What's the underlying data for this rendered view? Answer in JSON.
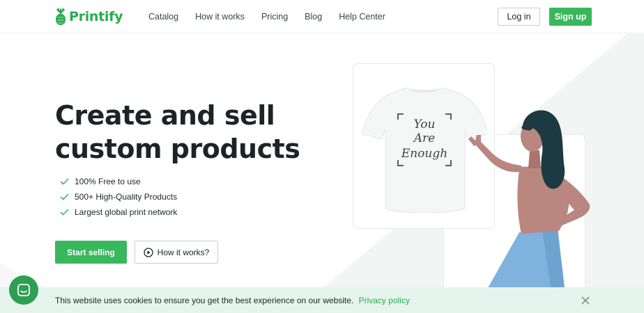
{
  "brand": {
    "name": "Printify",
    "color": "#29ab51"
  },
  "nav": {
    "items": [
      {
        "label": "Catalog"
      },
      {
        "label": "How it works"
      },
      {
        "label": "Pricing"
      },
      {
        "label": "Blog"
      },
      {
        "label": "Help Center"
      }
    ]
  },
  "auth": {
    "login_label": "Log in",
    "signup_label": "Sign up"
  },
  "hero": {
    "title_line1": "Create and sell",
    "title_line2": "custom products",
    "features": [
      "100% Free to use",
      "500+ High-Quality Products",
      "Largest global print network"
    ],
    "start_label": "Start selling",
    "how_label": "How it works?"
  },
  "illustration": {
    "shirt_print_lines": [
      "You",
      "Are",
      "Enough"
    ],
    "icons": [
      "tshirt-illustration",
      "woman-illustration"
    ]
  },
  "cookie": {
    "message": "This website uses cookies to ensure you get the best experience on our website.",
    "link_label": "Privacy policy"
  },
  "colors": {
    "accent": "#39b75d",
    "cookie_bg": "#e5f4ed",
    "text": "#1d2427",
    "skin": "#b98680",
    "hair": "#1d3942",
    "skirt": "#7fb2dd"
  }
}
